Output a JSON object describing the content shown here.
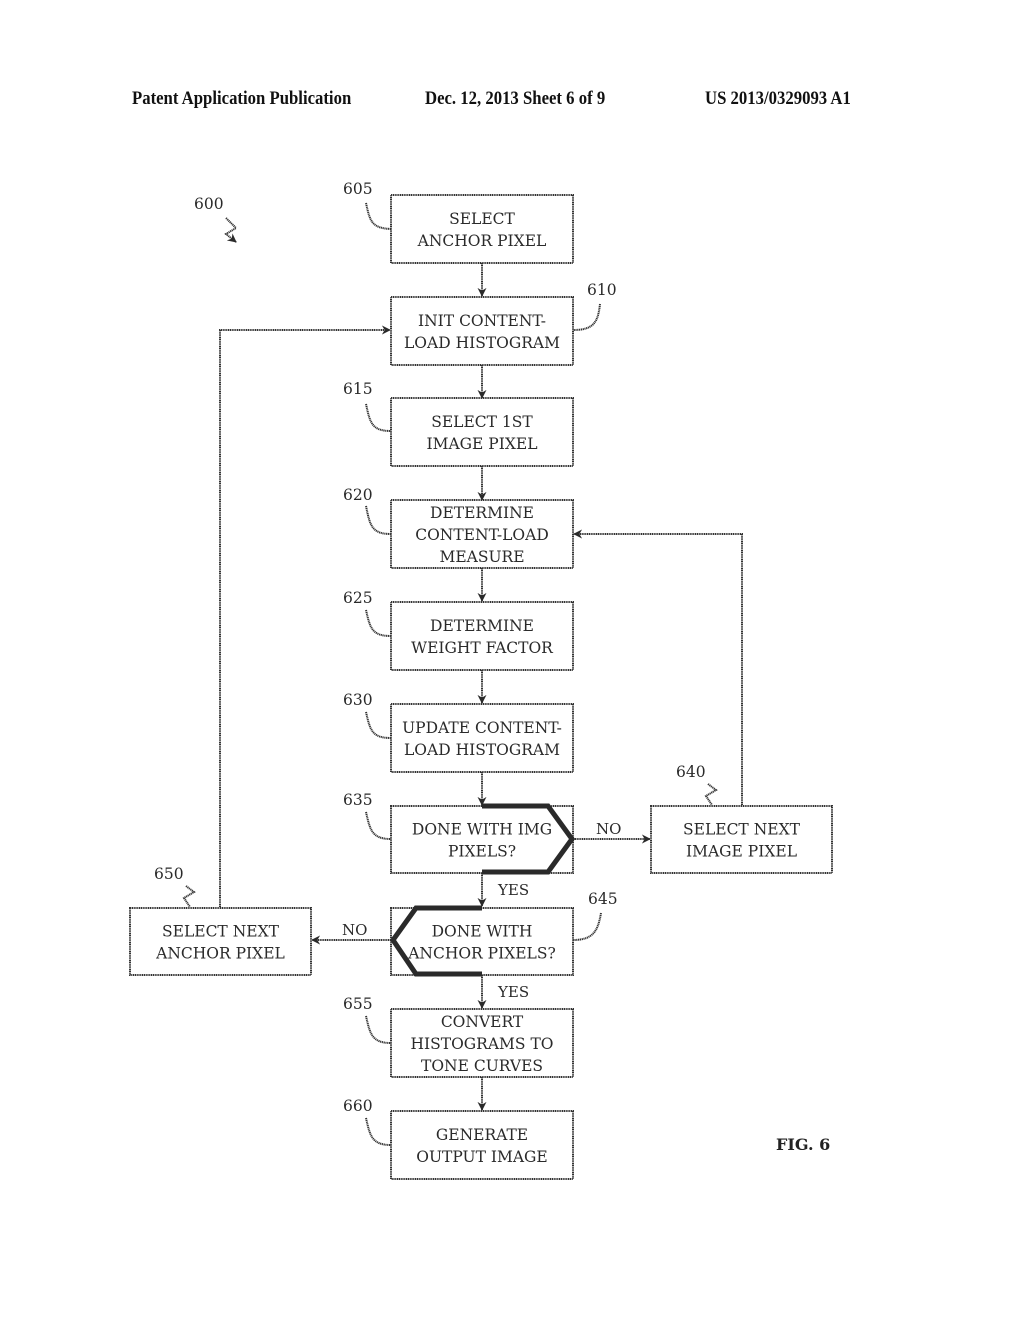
{
  "header": {
    "publication": "Patent Application Publication",
    "date_sheet": "Dec. 12, 2013   Sheet 6 of 9",
    "patent_number": "US 2013/0329093 A1"
  },
  "figure": {
    "label": "FIG. 6",
    "ref": "600"
  },
  "nodes": [
    {
      "id": "605",
      "ref": "605",
      "lines": [
        "SELECT",
        "ANCHOR PIXEL"
      ]
    },
    {
      "id": "610",
      "ref": "610",
      "lines": [
        "INIT CONTENT-",
        "LOAD HISTOGRAM"
      ]
    },
    {
      "id": "615",
      "ref": "615",
      "lines": [
        "SELECT 1ST",
        "IMAGE PIXEL"
      ]
    },
    {
      "id": "620",
      "ref": "620",
      "lines": [
        "DETERMINE",
        "CONTENT-LOAD",
        "MEASURE"
      ]
    },
    {
      "id": "625",
      "ref": "625",
      "lines": [
        "DETERMINE",
        "WEIGHT FACTOR"
      ]
    },
    {
      "id": "630",
      "ref": "630",
      "lines": [
        "UPDATE CONTENT-",
        "LOAD HISTOGRAM"
      ]
    },
    {
      "id": "635",
      "ref": "635",
      "lines": [
        "DONE WITH IMG",
        "PIXELS?"
      ]
    },
    {
      "id": "640",
      "ref": "640",
      "lines": [
        "SELECT NEXT",
        "IMAGE PIXEL"
      ]
    },
    {
      "id": "645",
      "ref": "645",
      "lines": [
        "DONE WITH",
        "ANCHOR PIXELS?"
      ]
    },
    {
      "id": "650",
      "ref": "650",
      "lines": [
        "SELECT NEXT",
        "ANCHOR PIXEL"
      ]
    },
    {
      "id": "655",
      "ref": "655",
      "lines": [
        "CONVERT",
        "HISTOGRAMS TO",
        "TONE CURVES"
      ]
    },
    {
      "id": "660",
      "ref": "660",
      "lines": [
        "GENERATE",
        "OUTPUT IMAGE"
      ]
    }
  ],
  "edge_labels": {
    "no_635": "NO",
    "yes_635": "YES",
    "no_645": "NO",
    "yes_645": "YES"
  }
}
